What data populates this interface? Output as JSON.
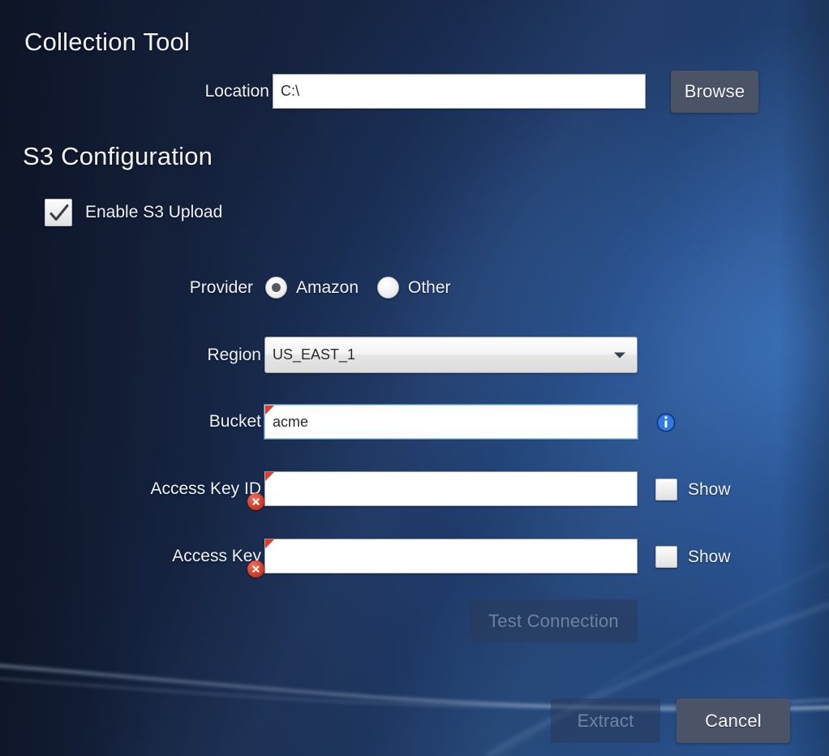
{
  "collection": {
    "title": "Collection Tool",
    "location": {
      "label": "Location",
      "value": "C:\\",
      "placeholder": ""
    },
    "browse_button": "Browse"
  },
  "s3": {
    "title": "S3 Configuration",
    "enable_upload": {
      "label": "Enable S3 Upload",
      "checked": true
    },
    "provider": {
      "label": "Provider",
      "options": [
        {
          "label": "Amazon",
          "selected": true
        },
        {
          "label": "Other",
          "selected": false
        }
      ]
    },
    "region": {
      "label": "Region",
      "value": "US_EAST_1"
    },
    "bucket": {
      "label": "Bucket",
      "value": "acme",
      "placeholder": "",
      "has_info": true,
      "validation": "flagged"
    },
    "access_key_id": {
      "label": "Access Key ID",
      "value": "",
      "placeholder": "",
      "show_label": "Show",
      "show_checked": false,
      "validation": "error"
    },
    "access_key": {
      "label": "Access Key",
      "value": "",
      "placeholder": "",
      "show_label": "Show",
      "show_checked": false,
      "validation": "error"
    },
    "test_connection_button": {
      "label": "Test Connection",
      "enabled": false
    }
  },
  "footer": {
    "extract_button": {
      "label": "Extract",
      "enabled": false
    },
    "cancel_button": {
      "label": "Cancel",
      "enabled": true
    }
  },
  "colors": {
    "background_dark": "#16233f",
    "background_light": "#2d5c9e",
    "button": "#4b5366",
    "error": "#d8402a",
    "info": "#2a6ad0",
    "focus_border": "#9fd0f0"
  }
}
